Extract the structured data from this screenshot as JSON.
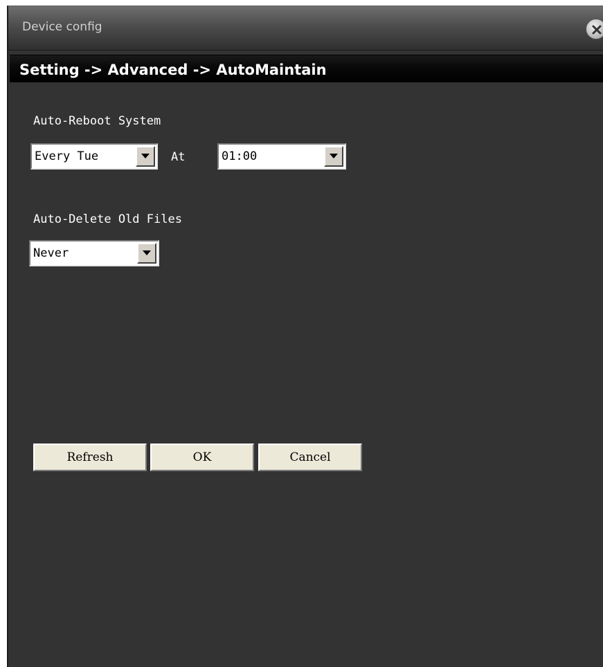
{
  "window": {
    "title": "Device config",
    "close_icon": "close-circle-icon"
  },
  "breadcrumb": "Setting -> Advanced -> AutoMaintain",
  "auto_reboot": {
    "label": "Auto-Reboot System",
    "day_value": "Every Tue",
    "at_label": "At",
    "time_value": "01:00"
  },
  "auto_delete": {
    "label": "Auto-Delete Old Files",
    "value": "Never"
  },
  "buttons": {
    "refresh": "Refresh",
    "ok": "OK",
    "cancel": "Cancel"
  },
  "colors": {
    "panel_bg": "#333333",
    "button_face": "#ece9d8"
  }
}
